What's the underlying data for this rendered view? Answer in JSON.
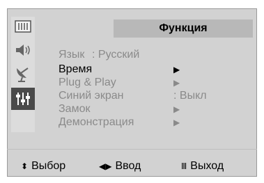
{
  "menu": {
    "title": "Функция",
    "items": [
      {
        "label": "Язык",
        "value": ": Русский",
        "active": false
      },
      {
        "label": "Время",
        "value": "▶",
        "active": true
      },
      {
        "label": "Plug & Play",
        "value": "▶",
        "active": false
      },
      {
        "label": "Синий экран",
        "value": ": Выкл",
        "active": false
      },
      {
        "label": "Замок",
        "value": "▶",
        "active": false
      },
      {
        "label": "Демонстрация",
        "value": "▶",
        "active": false
      }
    ]
  },
  "icons": [
    {
      "name": "picture-icon",
      "active": false
    },
    {
      "name": "sound-icon",
      "active": false
    },
    {
      "name": "channel-icon",
      "active": false
    },
    {
      "name": "function-icon",
      "active": true
    }
  ],
  "footer": {
    "select_icon": "⬍",
    "select_label": "Выбор",
    "enter_icon": "◀▶",
    "enter_label": "Ввод",
    "exit_icon": "Ⅲ",
    "exit_label": "Выход"
  },
  "colors": {
    "background": "#d2d2d2",
    "title_bar": "#b8b8b8",
    "active_icon_bg": "#4a4a4a",
    "inactive_text": "#8a8a8a",
    "active_text": "#000000"
  }
}
